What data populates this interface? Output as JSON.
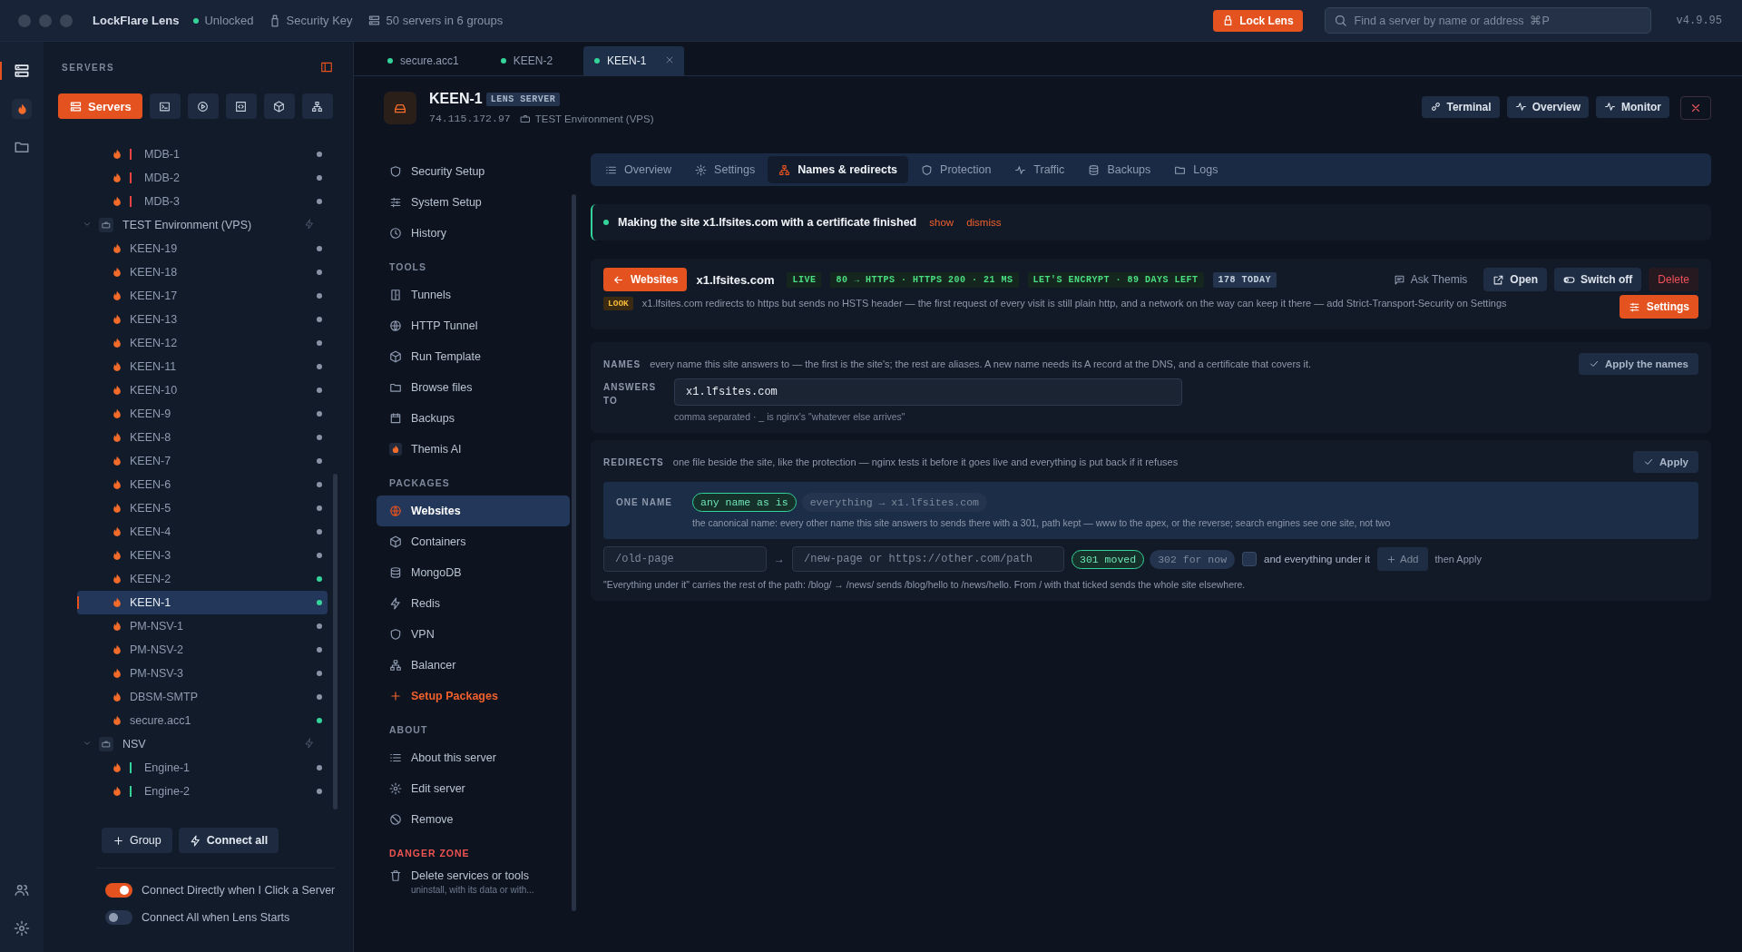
{
  "titlebar": {
    "app_name": "LockFlare Lens",
    "status": "Unlocked",
    "key": "Security Key",
    "summary": "50 servers in 6 groups",
    "lock_button": "Lock Lens",
    "search": {
      "placeholder": "Find a server by name or address  ⌘P"
    },
    "version": "v4.9.95"
  },
  "rail": [
    {
      "selected": true
    },
    {
      "selected": false
    },
    {
      "selected": false
    },
    {
      "selected": false
    },
    {
      "selected": false
    }
  ],
  "sidebar": {
    "title": "SERVERS",
    "toolbar": [
      {
        "label": "Servers",
        "selected": true
      },
      {
        "selected": false
      },
      {
        "selected": false
      },
      {
        "selected": false
      },
      {
        "selected": false
      },
      {
        "selected": false
      }
    ],
    "tree": [
      {
        "kind": "server",
        "label": "MDB-1",
        "tag": {
          "color": "#ef4444"
        },
        "color": "#8a94a6",
        "selected": false
      },
      {
        "kind": "server",
        "label": "MDB-2",
        "tag": {
          "color": "#ef4444"
        },
        "color": "#8a94a6",
        "selected": false
      },
      {
        "kind": "server",
        "label": "MDB-3",
        "tag": {
          "color": "#ef4444"
        },
        "color": "#8a94a6",
        "selected": false
      },
      {
        "kind": "group",
        "label": "TEST Environment (VPS)",
        "expanded": true,
        "children": [
          {
            "kind": "server",
            "label": "KEEN-19",
            "color": "#8a94a6",
            "selected": false
          },
          {
            "kind": "server",
            "label": "KEEN-18",
            "color": "#8a94a6",
            "selected": false
          },
          {
            "kind": "server",
            "label": "KEEN-17",
            "color": "#8a94a6",
            "selected": false
          },
          {
            "kind": "server",
            "label": "KEEN-13",
            "color": "#8a94a6",
            "selected": false
          },
          {
            "kind": "server",
            "label": "KEEN-12",
            "color": "#8a94a6",
            "selected": false
          },
          {
            "kind": "server",
            "label": "KEEN-11",
            "color": "#8a94a6",
            "selected": false
          },
          {
            "kind": "server",
            "label": "KEEN-10",
            "color": "#8a94a6",
            "selected": false
          },
          {
            "kind": "server",
            "label": "KEEN-9",
            "color": "#8a94a6",
            "selected": false
          },
          {
            "kind": "server",
            "label": "KEEN-8",
            "color": "#8a94a6",
            "selected": false
          },
          {
            "kind": "server",
            "label": "KEEN-7",
            "color": "#8a94a6",
            "selected": false
          },
          {
            "kind": "server",
            "label": "KEEN-6",
            "color": "#8a94a6",
            "selected": false
          },
          {
            "kind": "server",
            "label": "KEEN-5",
            "color": "#8a94a6",
            "selected": false
          },
          {
            "kind": "server",
            "label": "KEEN-4",
            "color": "#8a94a6",
            "selected": false
          },
          {
            "kind": "server",
            "label": "KEEN-3",
            "color": "#8a94a6",
            "selected": false
          },
          {
            "kind": "server",
            "label": "KEEN-2",
            "color": "#34d399",
            "selected": false
          },
          {
            "kind": "server",
            "label": "KEEN-1",
            "color": "#34d399",
            "selected": true
          },
          {
            "kind": "server",
            "label": "PM-NSV-1",
            "color": "#8a94a6",
            "selected": false
          },
          {
            "kind": "server",
            "label": "PM-NSV-2",
            "color": "#8a94a6",
            "selected": false
          },
          {
            "kind": "server",
            "label": "PM-NSV-3",
            "color": "#8a94a6",
            "selected": false
          },
          {
            "kind": "server",
            "label": "DBSM-SMTP",
            "color": "#8a94a6",
            "selected": false
          },
          {
            "kind": "server",
            "label": "secure.acc1",
            "color": "#34d399",
            "selected": false
          }
        ]
      },
      {
        "kind": "group",
        "label": "NSV",
        "expanded": true,
        "children": [
          {
            "kind": "server",
            "label": "Engine-1",
            "tag": {
              "color": "#34d399"
            },
            "color": "#8a94a6",
            "selected": false
          },
          {
            "kind": "server",
            "label": "Engine-2",
            "tag": {
              "color": "#34d399"
            },
            "color": "#8a94a6",
            "selected": false
          }
        ]
      }
    ],
    "buttons": [
      "Group",
      "Connect all"
    ],
    "toggles": [
      {
        "label": "Connect Directly when I Click a Server",
        "on": true
      },
      {
        "label": "Connect All when Lens Starts",
        "on": false
      }
    ]
  },
  "tabs": [
    {
      "label": "secure.acc1",
      "selected": false
    },
    {
      "label": "KEEN-2",
      "selected": false
    },
    {
      "label": "KEEN-1",
      "selected": true
    }
  ],
  "server": {
    "name": "KEEN-1",
    "badge": "LENS SERVER",
    "address": "74.115.172.97",
    "group": "TEST Environment (VPS)",
    "actions": [
      "Terminal",
      "Overview",
      "Monitor"
    ]
  },
  "nav": [
    {
      "items": [
        {
          "label": "Security Setup",
          "selected": false
        },
        {
          "label": "System Setup",
          "selected": false
        },
        {
          "label": "History",
          "selected": false
        }
      ]
    },
    {
      "title": "TOOLS",
      "items": [
        {
          "label": "Tunnels",
          "selected": false
        },
        {
          "label": "HTTP Tunnel",
          "selected": false
        },
        {
          "label": "Run Template",
          "selected": false
        },
        {
          "label": "Browse files",
          "selected": false
        },
        {
          "label": "Backups",
          "selected": false
        },
        {
          "label": "Themis AI",
          "selected": false
        }
      ]
    },
    {
      "title": "PACKAGES",
      "items": [
        {
          "label": "Websites",
          "selected": true
        },
        {
          "label": "Containers",
          "selected": false
        },
        {
          "label": "MongoDB",
          "selected": false
        },
        {
          "label": "Redis",
          "selected": false
        },
        {
          "label": "VPN",
          "selected": false
        },
        {
          "label": "Balancer",
          "selected": false
        },
        {
          "label": "Setup Packages",
          "kind": "action",
          "selected": false
        }
      ]
    },
    {
      "title": "ABOUT",
      "items": [
        {
          "label": "About this server",
          "selected": false
        },
        {
          "label": "Edit server",
          "selected": false
        },
        {
          "label": "Remove",
          "selected": false
        }
      ]
    },
    {
      "title": "DANGER ZONE",
      "kind": "danger",
      "items": [
        {
          "label": "Delete services or tools",
          "sub": "uninstall, with its data or with...",
          "selected": false
        }
      ]
    }
  ],
  "content_tabs": [
    {
      "label": "Overview",
      "selected": false
    },
    {
      "label": "Settings",
      "selected": false
    },
    {
      "label": "Names & redirects",
      "selected": true
    },
    {
      "label": "Protection",
      "selected": false
    },
    {
      "label": "Traffic",
      "selected": false
    },
    {
      "label": "Backups",
      "selected": false
    },
    {
      "label": "Logs",
      "selected": false
    }
  ],
  "notice": {
    "text": "Making the site x1.lfsites.com with a certificate finished",
    "links": [
      "show",
      "dismiss"
    ]
  },
  "site": {
    "back_button": "Websites",
    "domain": "x1.lfsites.com",
    "badges": [
      {
        "text": "LIVE",
        "kind": "good"
      },
      {
        "text": "80 → HTTPS · HTTPS 200 · 21 MS",
        "kind": "good"
      },
      {
        "text": "LET'S ENCRYPT · 89 DAYS LEFT",
        "kind": "good"
      },
      {
        "text": "178 TODAY",
        "kind": "info"
      }
    ],
    "actions": [
      {
        "label": "Ask Themis",
        "kind": "plain"
      },
      {
        "label": "Open",
        "kind": "secondary"
      },
      {
        "label": "Switch off",
        "kind": "secondary"
      },
      {
        "label": "Delete",
        "kind": "danger"
      }
    ],
    "warning": {
      "tag": "LOOK",
      "text": "x1.lfsites.com redirects to https but sends no HSTS header — the first request of every visit is still plain http, and a network on the way can keep it there — add Strict-Transport-Security on Settings"
    },
    "settings_button": "Settings"
  },
  "names": {
    "label": "NAMES",
    "description": "every name this site answers to — the first is the site's; the rest are aliases. A new name needs its A record at the DNS, and a certificate that covers it.",
    "button": "Apply the names",
    "field_label": "ANSWERS TO",
    "value": "x1.lfsites.com",
    "hint": "comma separated · _ is nginx's \"whatever else arrives\""
  },
  "redirects": {
    "label": "REDIRECTS",
    "description": "one file beside the site, like the protection — nginx tests it before it goes live and everything is put back if it refuses",
    "button": "Apply",
    "one_name": {
      "label": "ONE NAME",
      "options": [
        {
          "label": "any name as is",
          "selected": true
        },
        {
          "label": "everything → x1.lfsites.com",
          "selected": false
        }
      ],
      "description": "the canonical name: every other name this site answers to sends there with a 301, path kept — www to the apex, or the reverse; search engines see one site, not two"
    },
    "from": {
      "placeholder": "/old-page"
    },
    "arrow": "→",
    "to": {
      "placeholder": "/new-page or https://other.com/path"
    },
    "codes": [
      {
        "label": "301 moved",
        "selected": true
      },
      {
        "label": "302 for now",
        "selected": false
      }
    ],
    "subtree": {
      "label": "and everything under it",
      "checked": false
    },
    "add_button": "Add",
    "after": "then Apply",
    "footnote": "\"Everything under it\" carries the rest of the path: /blog/ → /news/ sends /blog/hello to /news/hello. From / with that ticked sends the whole site elsewhere."
  }
}
